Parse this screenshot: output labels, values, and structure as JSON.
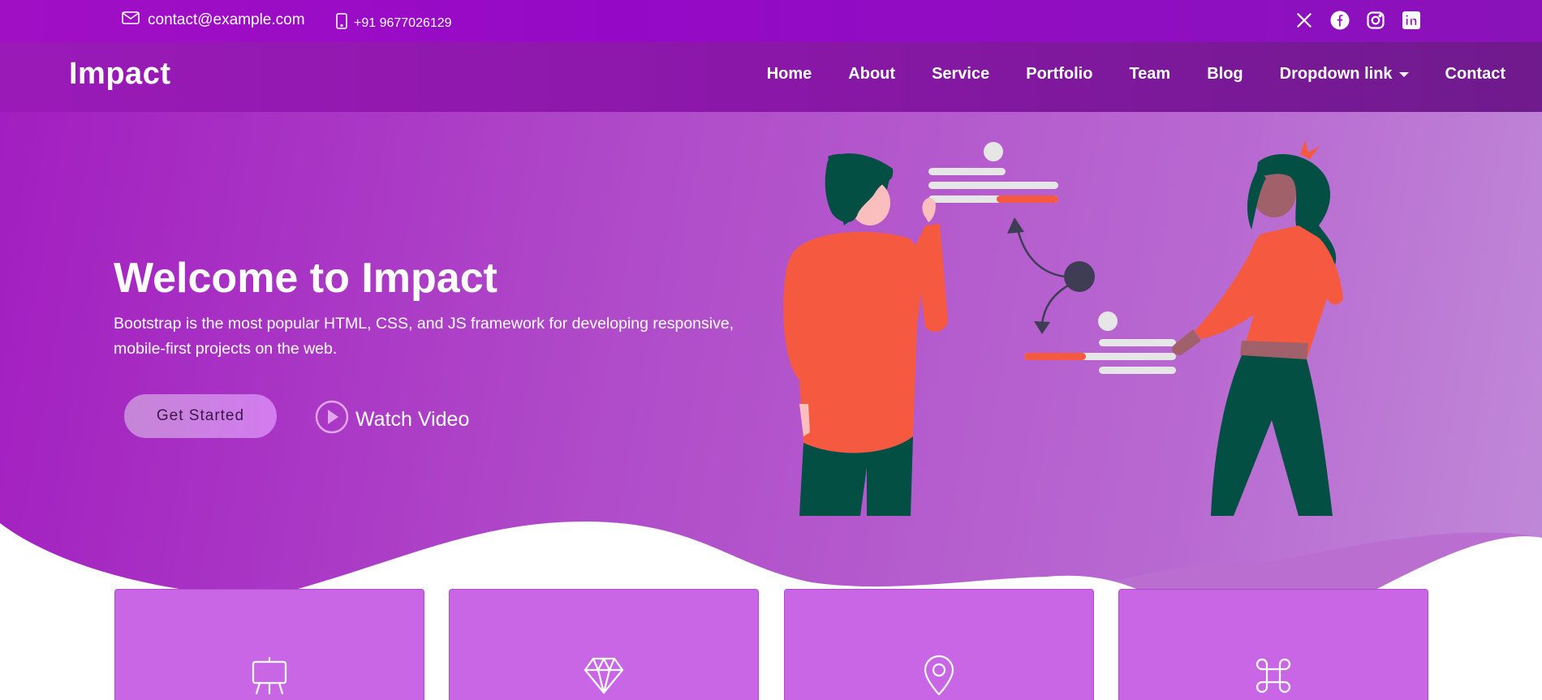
{
  "topbar": {
    "email": "contact@example.com",
    "phone": "+91 9677026129",
    "email_icon": "envelope-icon",
    "phone_icon": "phone-icon",
    "socials": [
      "x-twitter-icon",
      "facebook-icon",
      "instagram-icon",
      "linkedin-icon"
    ]
  },
  "header": {
    "logo": "Impact",
    "nav": [
      {
        "label": "Home"
      },
      {
        "label": "About"
      },
      {
        "label": "Service"
      },
      {
        "label": "Portfolio"
      },
      {
        "label": "Team"
      },
      {
        "label": "Blog"
      },
      {
        "label": "Dropdown link",
        "dropdown": true
      },
      {
        "label": "Contact"
      }
    ]
  },
  "hero": {
    "title": "Welcome to Impact",
    "subtitle": "Bootstrap is the most popular HTML, CSS, and JS framework for developing responsive, mobile-first projects on the web.",
    "cta_primary": "Get Started",
    "cta_secondary": "Watch Video",
    "cta_secondary_icon": "play-circle-icon"
  },
  "cards": [
    {
      "icon": "easel-icon"
    },
    {
      "icon": "gem-icon"
    },
    {
      "icon": "geo-pin-icon"
    },
    {
      "icon": "command-icon"
    }
  ],
  "colors": {
    "topbar": "#9509c6",
    "header": "#8a17a8",
    "hero_start": "#a21ec0",
    "hero_end": "#c08ad8",
    "card": "#c966e6",
    "accent": "#f55a40",
    "figure_dark": "#034f44"
  }
}
